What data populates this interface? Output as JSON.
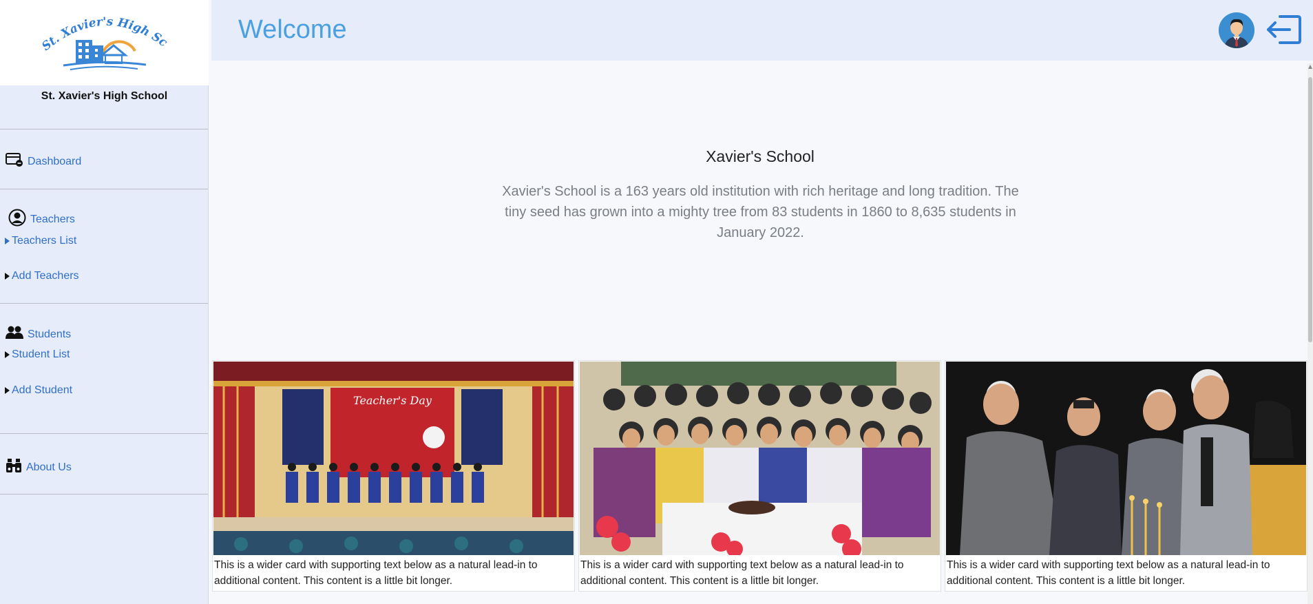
{
  "sidebar": {
    "logo_text": "St. Xavier's High School",
    "school_name": "St. Xavier's High School",
    "dashboard": "Dashboard",
    "teachers": {
      "heading": "Teachers",
      "list": "Teachers List",
      "add": "Add Teachers"
    },
    "students": {
      "heading": "Students",
      "list": "Student List",
      "add": "Add Student"
    },
    "about": "About Us"
  },
  "header": {
    "title": "Welcome"
  },
  "hero": {
    "title": "Xavier's School",
    "text": "Xavier's School is a 163 years old institution with rich heritage and long tradition. The tiny seed has grown into a mighty tree from 83 students in 1860 to 8,635 students in January 2022."
  },
  "cards": [
    {
      "banner_text": "Teacher's Day",
      "text": "This is a wider card with supporting text below as a natural lead-in to additional content. This content is a little bit longer."
    },
    {
      "text": "This is a wider card with supporting text below as a natural lead-in to additional content. This content is a little bit longer."
    },
    {
      "text": "This is a wider card with supporting text below as a natural lead-in to additional content. This content is a little bit longer."
    }
  ],
  "colors": {
    "accent": "#2f6fca",
    "title": "#4aa0e0",
    "sidebar_bg": "#e7ecfa"
  }
}
